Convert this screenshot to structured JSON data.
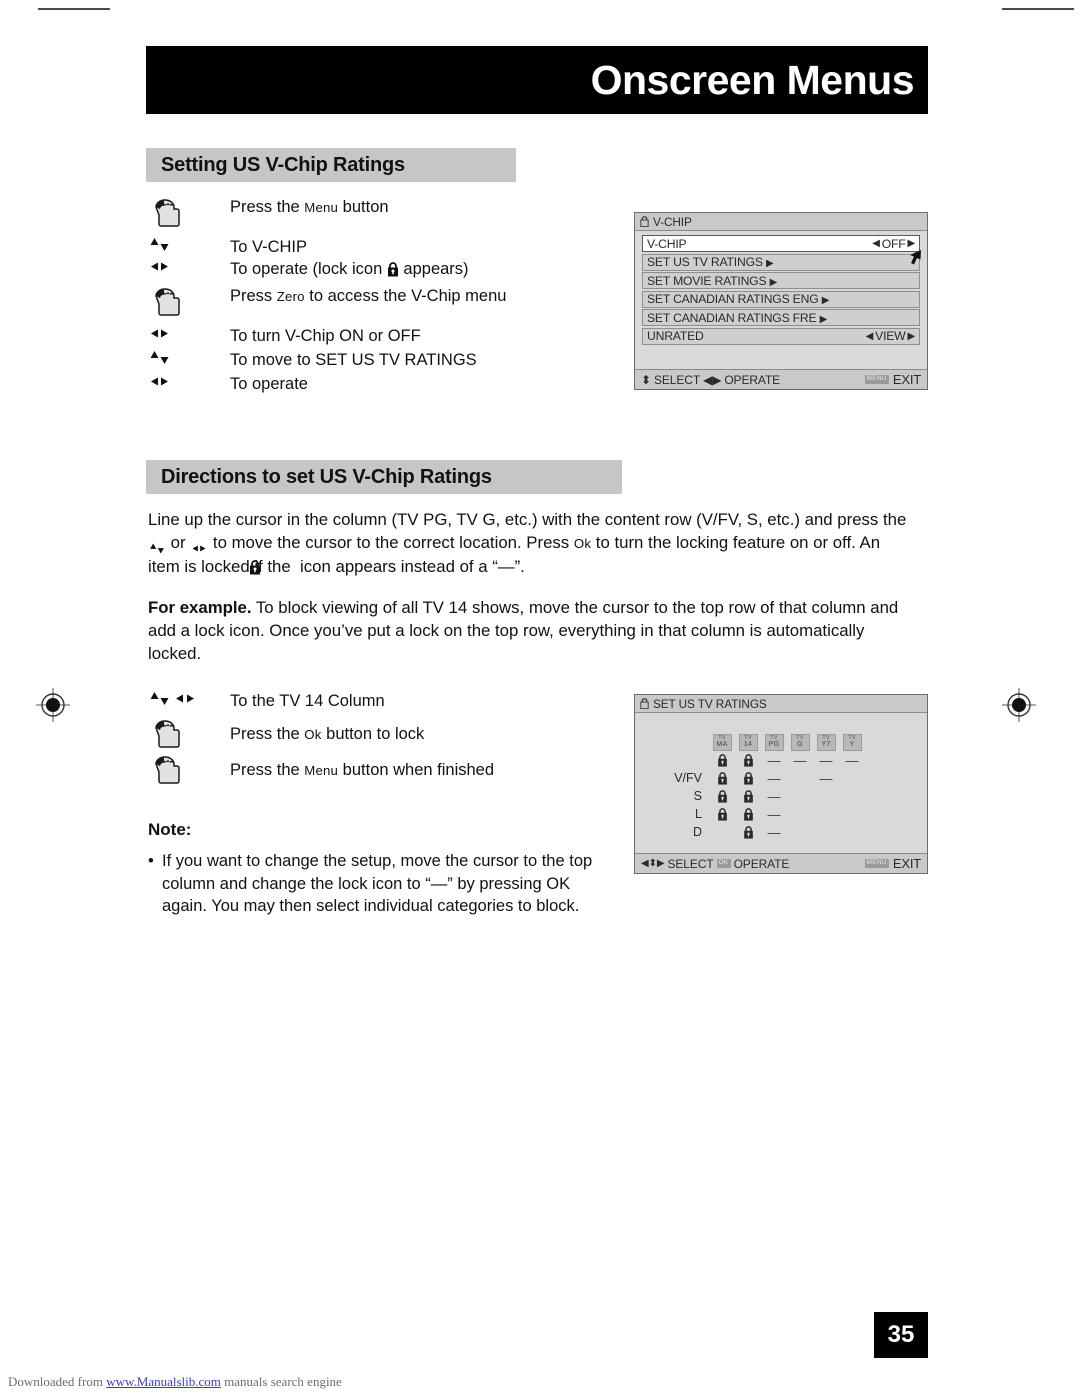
{
  "page": {
    "banner_title": "Onscreen Menus",
    "page_number": "35",
    "footer_prefix": "Downloaded from ",
    "footer_link": "www.Manualslib.com",
    "footer_suffix": " manuals search engine"
  },
  "section1": {
    "heading": "Setting US V-Chip Ratings",
    "steps": [
      {
        "cue": "hand-press-icon",
        "text_pre": "Press the ",
        "text_sc": "Menu",
        "text_post": " button"
      },
      {
        "cue": "up-down-arrows-icon",
        "text_pre": "To V-CHIP",
        "text_sc": "",
        "text_post": ""
      },
      {
        "cue": "left-right-arrows-icon",
        "text_pre": "To operate (lock icon ",
        "text_sc": "",
        "text_post": " appears)",
        "has_lock": true
      },
      {
        "cue": "hand-press-icon",
        "text_pre": "Press ",
        "text_sc": "Zero",
        "text_post": " to access the V-Chip menu"
      },
      {
        "cue": "left-right-arrows-icon",
        "text_pre": "To turn V-Chip ON or OFF",
        "text_sc": "",
        "text_post": ""
      },
      {
        "cue": "up-down-arrows-icon",
        "text_pre": "To move to SET US TV RATINGS",
        "text_sc": "",
        "text_post": ""
      },
      {
        "cue": "left-right-arrows-icon",
        "text_pre": "To operate",
        "text_sc": "",
        "text_post": ""
      }
    ]
  },
  "vchip_menu": {
    "title": "V-CHIP",
    "rows": [
      {
        "label": "V-CHIP",
        "value": "OFF",
        "type": "value",
        "selected": true
      },
      {
        "label": "SET US TV RATINGS",
        "value": "",
        "type": "submenu",
        "selected": false
      },
      {
        "label": "SET MOVIE RATINGS",
        "value": "",
        "type": "submenu",
        "selected": false
      },
      {
        "label": "SET CANADIAN RATINGS ENG",
        "value": "",
        "type": "submenu",
        "selected": false
      },
      {
        "label": "SET CANADIAN RATINGS FRE",
        "value": "",
        "type": "submenu",
        "selected": false
      },
      {
        "label": "UNRATED",
        "value": "VIEW",
        "type": "value",
        "selected": false
      }
    ],
    "footer_select": "SELECT",
    "footer_operate": "OPERATE",
    "footer_keycap": "MENU",
    "footer_exit": "EXIT"
  },
  "section2": {
    "heading": "Directions to set US V-Chip Ratings",
    "para1_a": "Line up the cursor in the column (TV PG, TV G, etc.) with the content row (V/FV, S, etc.) and press the ",
    "para1_b": " or ",
    "para1_c": " to move the cursor to the correct location. Press ",
    "para1_ok": "Ok",
    "para1_d": " to turn the locking feature on or off. An item is locked if the ",
    "para1_e": " icon appears instead of a “—”.",
    "para2_bold": "For example.",
    "para2_text": " To block viewing of all TV 14 shows, move the cursor to the top row of that column and add a lock icon. Once you’ve put a lock on the top row, everything in that column is automatically locked.",
    "steps": [
      {
        "cue": "up-down-left-right-arrows-icon",
        "text_pre": "To the TV 14 Column",
        "text_sc": "",
        "text_post": ""
      },
      {
        "cue": "hand-press-icon",
        "text_pre": "Press the ",
        "text_sc": "Ok",
        "text_post": " button to lock"
      },
      {
        "cue": "hand-press-icon",
        "text_pre": "Press the ",
        "text_sc": "Menu",
        "text_post": " button when finished"
      }
    ],
    "note_title": "Note:",
    "note_bullet": "If you want to change the setup, move the cursor to the top column and change the lock icon to “—” by pressing OK again. You may then select individual categories to block."
  },
  "ratings_menu": {
    "title": "SET US TV RATINGS",
    "columns": [
      {
        "top": "TV",
        "bottom": "MA"
      },
      {
        "top": "TV",
        "bottom": "14"
      },
      {
        "top": "TV",
        "bottom": "PG"
      },
      {
        "top": "TV",
        "bottom": "G"
      },
      {
        "top": "TV",
        "bottom": "Y7"
      },
      {
        "top": "TV",
        "bottom": "Y"
      }
    ],
    "rows": [
      {
        "label": "",
        "cells": [
          "lock",
          "lock",
          "dash",
          "dash",
          "dash",
          "dash"
        ]
      },
      {
        "label": "V/FV",
        "cells": [
          "lock",
          "lock",
          "dash",
          "",
          "dash",
          ""
        ]
      },
      {
        "label": "S",
        "cells": [
          "lock",
          "lock",
          "dash",
          "",
          "",
          ""
        ]
      },
      {
        "label": "L",
        "cells": [
          "lock",
          "lock",
          "dash",
          "",
          "",
          ""
        ]
      },
      {
        "label": "D",
        "cells": [
          "",
          "lock",
          "dash",
          "",
          "",
          ""
        ]
      }
    ],
    "footer_select": "SELECT",
    "footer_okcap": "OK",
    "footer_operate": "OPERATE",
    "footer_keycap": "MENU",
    "footer_exit": "EXIT"
  },
  "colors": {
    "banner_bg": "#000000",
    "section_head_bg": "#c6c6c6",
    "osd_bg": "#d9d9d9",
    "osd_chrome": "#c9c9c9",
    "osd_row": "#cfcfcf",
    "osd_row_selected": "#ffffff",
    "link": "#3b3bc8"
  }
}
